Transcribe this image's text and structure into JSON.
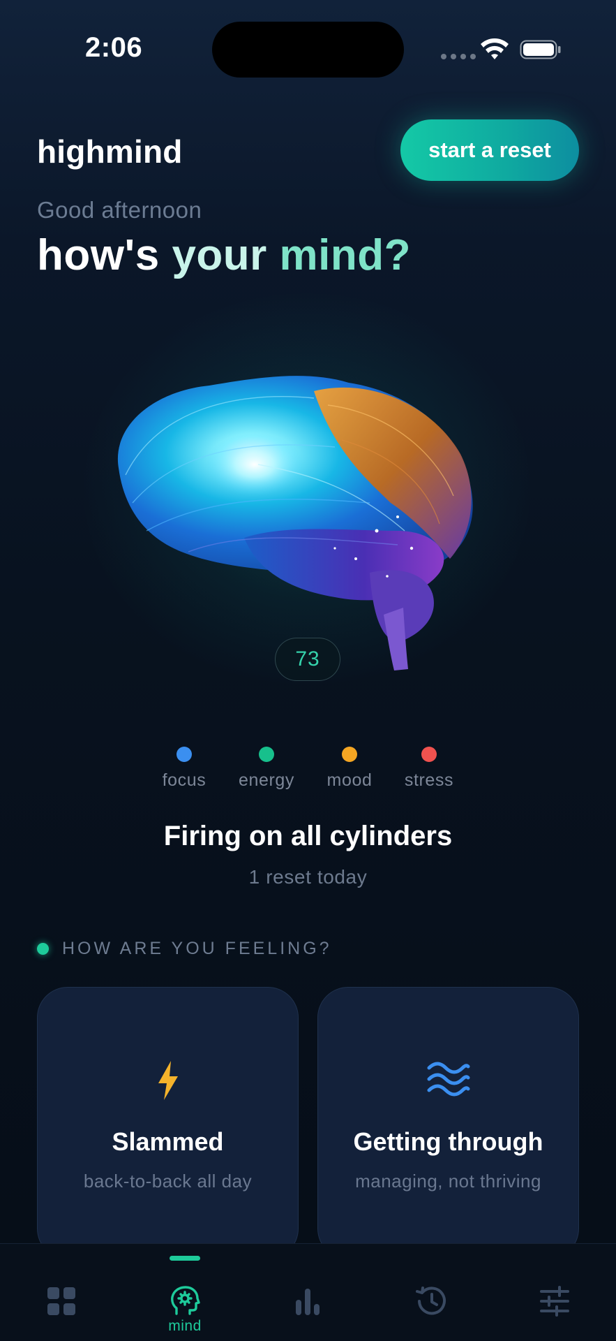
{
  "status_bar": {
    "time": "2:06"
  },
  "header": {
    "brand": "highmind",
    "reset_button": "start a reset",
    "greeting": "Good afternoon",
    "headline_words": [
      "how's",
      "your",
      "mind?"
    ]
  },
  "brain": {
    "score": "73"
  },
  "legend": [
    {
      "label": "focus",
      "color": "#3b8ff0"
    },
    {
      "label": "energy",
      "color": "#17c08c"
    },
    {
      "label": "mood",
      "color": "#f5a623"
    },
    {
      "label": "stress",
      "color": "#f0524f"
    }
  ],
  "state": {
    "title": "Firing on all cylinders",
    "subtitle": "1 reset today"
  },
  "feeling": {
    "section_label": "HOW ARE YOU FEELING?",
    "cards": [
      {
        "title": "Slammed",
        "subtitle": "back-to-back all day",
        "icon": "lightning-icon",
        "icon_color": "#f5b32b"
      },
      {
        "title": "Getting through",
        "subtitle": "managing, not thriving",
        "icon": "waves-icon",
        "icon_color": "#3b8ff0"
      }
    ]
  },
  "tabbar": {
    "tabs": [
      {
        "icon": "grid-icon"
      },
      {
        "icon": "brain-head-icon",
        "label": "mind",
        "active": true
      },
      {
        "icon": "bar-chart-icon"
      },
      {
        "icon": "history-icon"
      },
      {
        "icon": "sliders-icon"
      }
    ],
    "active_color": "#1ecb9b",
    "inactive_color": "#3a4a62"
  }
}
